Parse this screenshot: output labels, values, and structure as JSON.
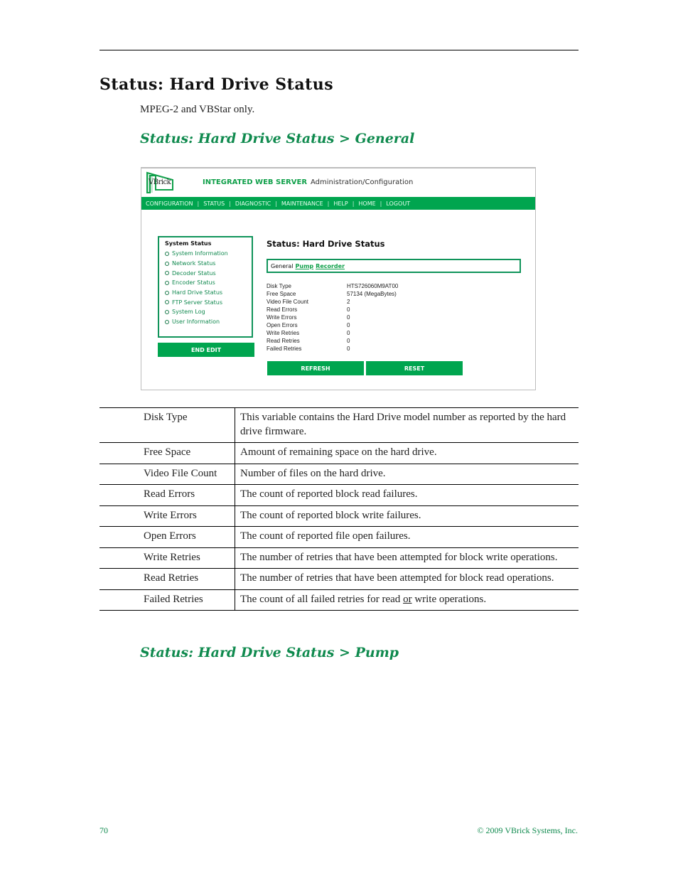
{
  "page": {
    "heading": "Status: Hard Drive Status",
    "note": "MPEG-2 and VBStar only.",
    "section_general": "Status: Hard Drive Status > General",
    "section_pump": "Status: Hard Drive Status > Pump"
  },
  "screenshot": {
    "logo_text": "VBrick",
    "title_brand": "INTEGRATED WEB SERVER",
    "title_sub": "Administration/Configuration",
    "nav": [
      "CONFIGURATION",
      "STATUS",
      "DIAGNOSTIC",
      "MAINTENANCE",
      "HELP",
      "HOME",
      "LOGOUT"
    ],
    "sidebar": {
      "title": "System Status",
      "items": [
        "System Information",
        "Network Status",
        "Decoder Status",
        "Encoder Status",
        "Hard Drive Status",
        "FTP Server Status",
        "System Log",
        "User Information"
      ]
    },
    "end_edit_label": "END EDIT",
    "content_title": "Status: Hard Drive Status",
    "tabs": {
      "current": "General",
      "links": [
        "Pump",
        "Recorder"
      ]
    },
    "fields": [
      {
        "label": "Disk Type",
        "value": "HTS726060M9AT00"
      },
      {
        "label": "Free Space",
        "value": "57134 (MegaBytes)"
      },
      {
        "label": "Video File Count",
        "value": "2"
      },
      {
        "label": "Read Errors",
        "value": "0"
      },
      {
        "label": "Write Errors",
        "value": "0"
      },
      {
        "label": "Open Errors",
        "value": "0"
      },
      {
        "label": "Write Retries",
        "value": "0"
      },
      {
        "label": "Read Retries",
        "value": "0"
      },
      {
        "label": "Failed Retries",
        "value": "0"
      }
    ],
    "refresh_label": "REFRESH",
    "reset_label": "RESET",
    "colors": {
      "brand_green": "#00a54f",
      "link_green": "#10a04a",
      "heading_green": "#0f8a4e"
    }
  },
  "table": {
    "rows": [
      {
        "term": "Disk Type",
        "desc": "This variable contains the Hard Drive model number as reported by the hard drive firmware."
      },
      {
        "term": "Free Space",
        "desc": "Amount of remaining space on the hard drive."
      },
      {
        "term": "Video File Count",
        "desc": "Number of files on the hard drive."
      },
      {
        "term": "Read Errors",
        "desc": "The count of reported block read failures."
      },
      {
        "term": "Write Errors",
        "desc": "The count of reported block write failures."
      },
      {
        "term": "Open Errors",
        "desc": "The count of reported file open failures."
      },
      {
        "term": "Write Retries",
        "desc": "The number of retries that have been attempted for block write operations."
      },
      {
        "term": "Read Retries",
        "desc": "The number of retries that have been attempted for block read operations."
      },
      {
        "term": "Failed Retries",
        "desc_pre": "The count of all failed retries for read ",
        "desc_underlined": "or",
        "desc_post": " write operations."
      }
    ]
  },
  "footer": {
    "page_number": "70",
    "copyright": "© 2009 VBrick Systems, Inc."
  }
}
